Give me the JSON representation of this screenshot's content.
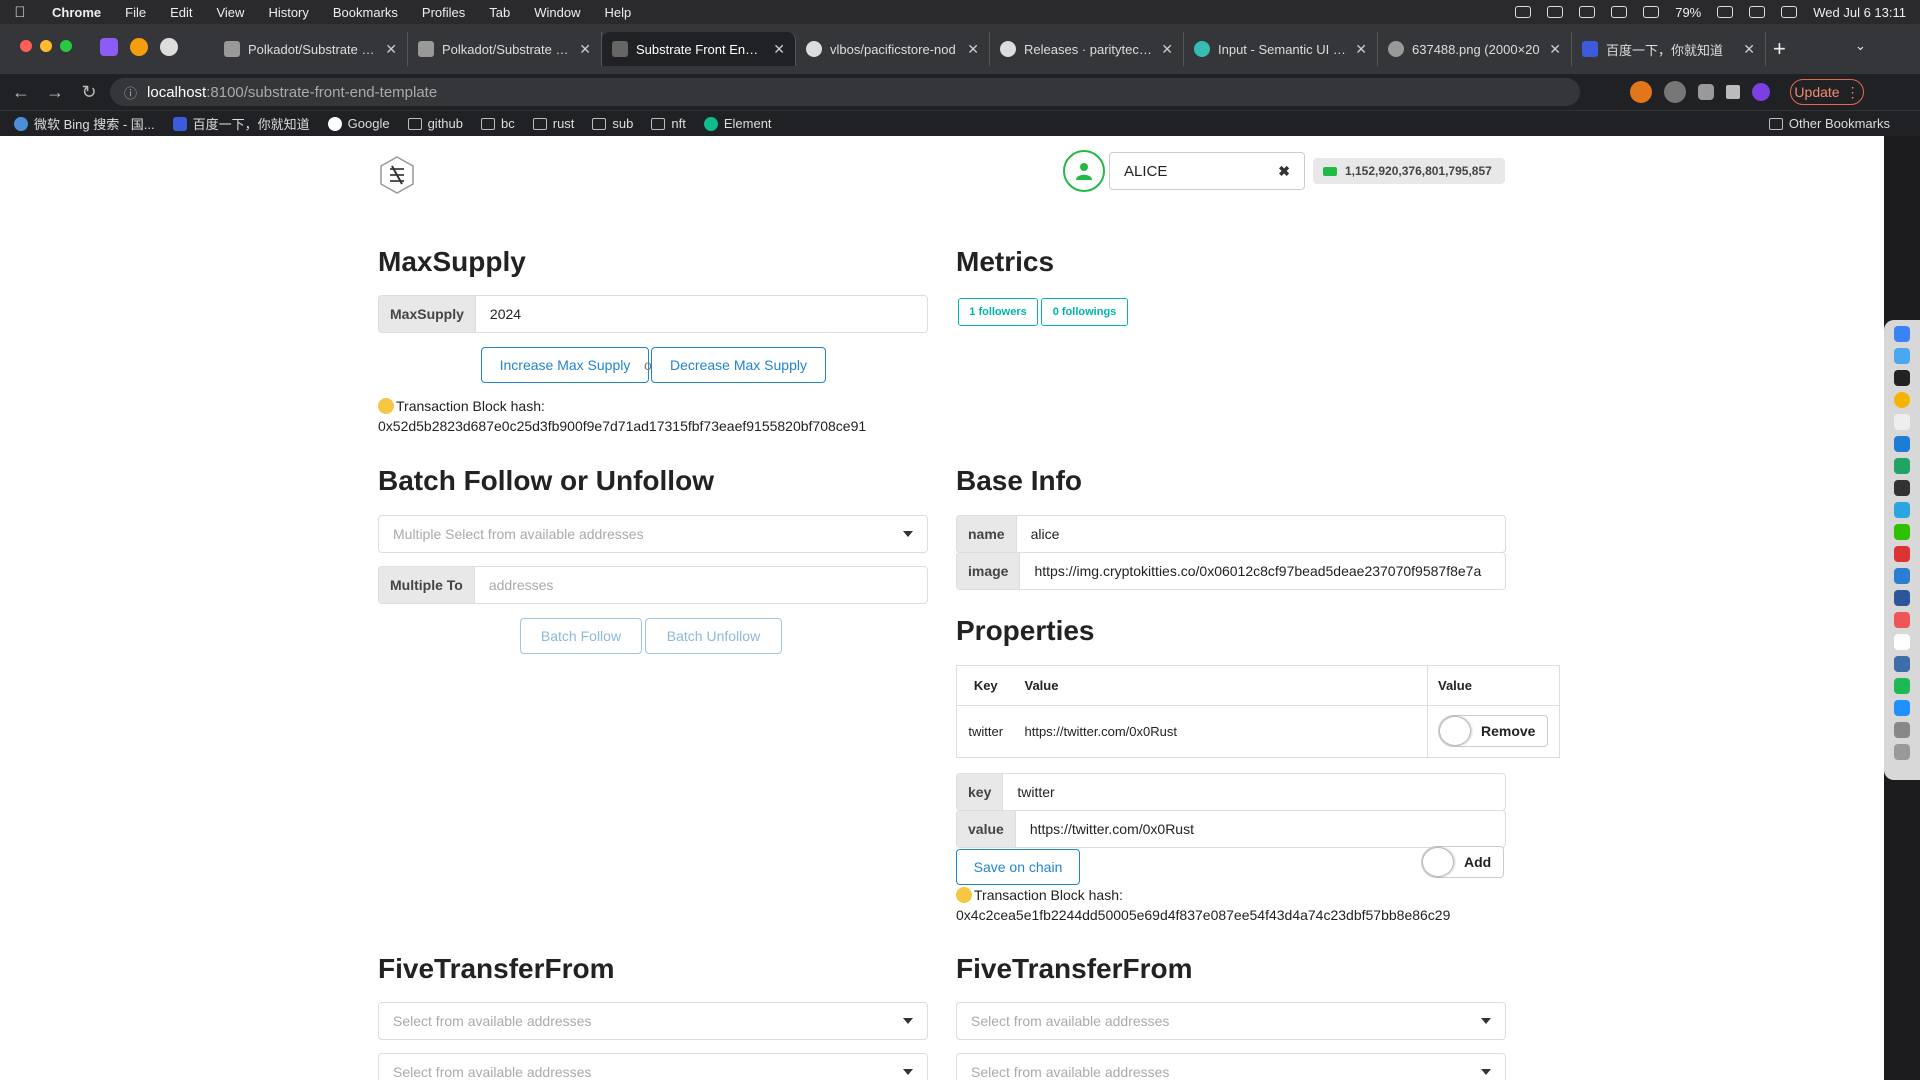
{
  "menubar": {
    "app": "Chrome",
    "items": [
      "File",
      "Edit",
      "View",
      "History",
      "Bookmarks",
      "Profiles",
      "Tab",
      "Window",
      "Help"
    ],
    "battery": "79%",
    "datetime": "Wed Jul 6  13:11"
  },
  "tabs": [
    {
      "title": "Polkadot/Substrate Po"
    },
    {
      "title": "Polkadot/Substrate Po"
    },
    {
      "title": "Substrate Front End Te"
    },
    {
      "title": "vlbos/pacificstore-nod"
    },
    {
      "title": "Releases · paritytech/s"
    },
    {
      "title": "Input - Semantic UI Re"
    },
    {
      "title": "637488.png (2000×20"
    },
    {
      "title": "百度一下，你就知道"
    }
  ],
  "url": {
    "host": "localhost",
    "path": ":8100/substrate-front-end-template"
  },
  "update_label": "Update",
  "bookmarks": [
    "微软 Bing 搜索 - 国...",
    "百度一下，你就知道",
    "Google",
    "github",
    "bc",
    "rust",
    "sub",
    "nft",
    "Element"
  ],
  "other_bookmarks": "Other Bookmarks",
  "account": {
    "name": "ALICE",
    "balance": "1,152,920,376,801,795,857"
  },
  "maxsupply": {
    "title": "MaxSupply",
    "label": "MaxSupply",
    "value": "2024",
    "increase": "Increase Max Supply",
    "or": "or",
    "decrease": "Decrease Max Supply",
    "tx_label": "Transaction Block hash:",
    "tx_hash": "0x52d5b2823d687e0c25d3fb900f9e7d71ad17315fbf73eaef9155820bf708ce91"
  },
  "metrics": {
    "title": "Metrics",
    "followers": "1 followers",
    "followings": "0 followings"
  },
  "batch": {
    "title": "Batch Follow or Unfollow",
    "select_placeholder": "Multiple Select from available addresses",
    "to_label": "Multiple To",
    "to_placeholder": "addresses",
    "follow": "Batch Follow",
    "unfollow": "Batch Unfollow"
  },
  "baseinfo": {
    "title": "Base Info",
    "name_label": "name",
    "name_value": "alice",
    "image_label": "image",
    "image_value": "https://img.cryptokitties.co/0x06012c8cf97bead5deae237070f9587f8e7a"
  },
  "properties": {
    "title": "Properties",
    "headers": [
      "Key",
      "Value",
      "Value"
    ],
    "rows": [
      {
        "key": "twitter",
        "value": "https://twitter.com/0x0Rust",
        "action": "Remove"
      }
    ],
    "key_label": "key",
    "key_value": "twitter",
    "value_label": "value",
    "value_value": "https://twitter.com/0x0Rust",
    "save": "Save on chain",
    "add": "Add",
    "tx_label": "Transaction Block hash:",
    "tx_hash": "0x4c2cea5e1fb2244dd50005e69d4f837e087ee54f43d4a74c23dbf57bb8e86c29"
  },
  "five_left": {
    "title": "FiveTransferFrom",
    "select1": "Select from available addresses",
    "select2": "Select from available addresses"
  },
  "five_right": {
    "title": "FiveTransferFrom",
    "select1": "Select from available addresses",
    "select2": "Select from available addresses"
  },
  "colors": {
    "accent": "#2185d0",
    "teal": "#00b5ad",
    "green": "#21ba45"
  }
}
